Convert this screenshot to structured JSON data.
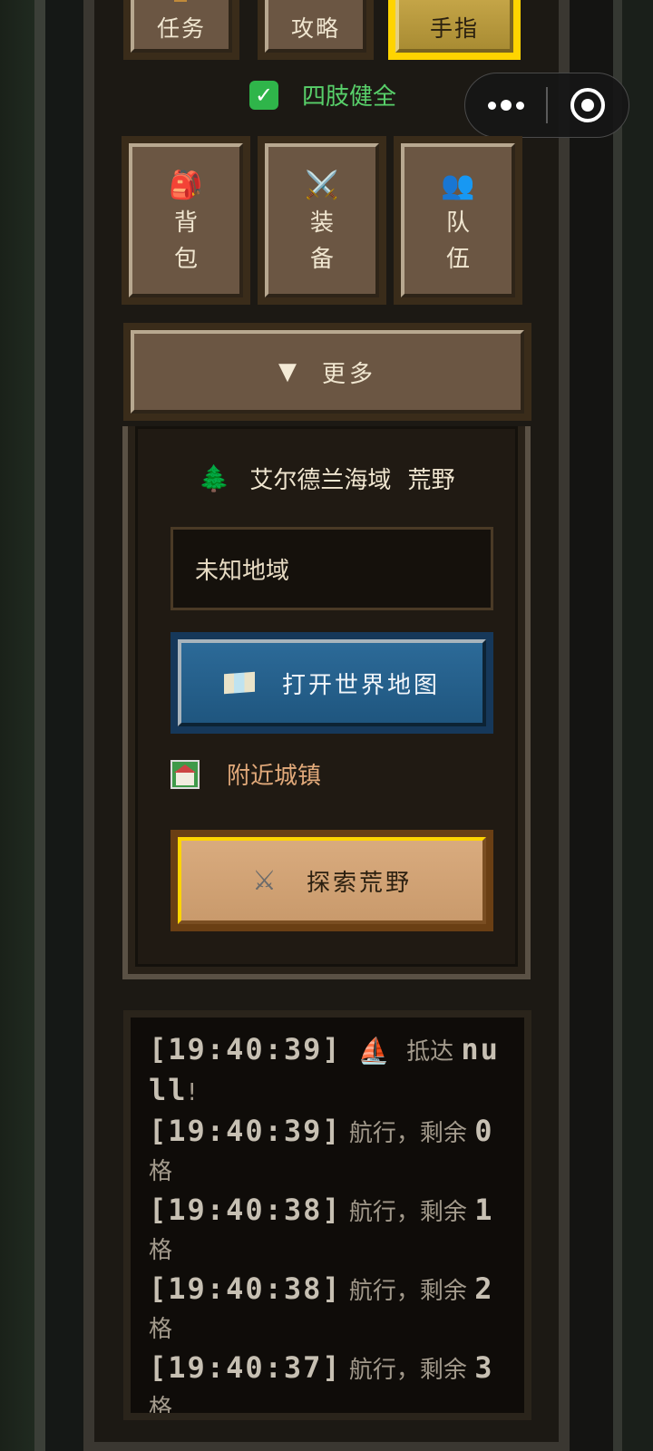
{
  "top_buttons": [
    {
      "label": "任务"
    },
    {
      "label": "攻略"
    },
    {
      "label": "手指",
      "active": true
    }
  ],
  "status": {
    "check_icon": "check-mark-icon",
    "label": "四肢健全",
    "color": "#58d06a"
  },
  "capsule": {
    "more_icon": "more-dots-icon",
    "close_icon": "target-close-icon"
  },
  "actions": [
    {
      "icon": "backpack-icon",
      "glyph": "🎒",
      "label_lines": [
        "背",
        "包"
      ]
    },
    {
      "icon": "crossed-swords-icon",
      "glyph": "⚔️",
      "label_lines": [
        "装",
        "备"
      ]
    },
    {
      "icon": "team-icon",
      "glyph": "👥",
      "label_lines": [
        "队",
        "伍"
      ]
    }
  ],
  "more": {
    "icon": "funnel-icon",
    "label": "更多"
  },
  "location": {
    "icon": "tree-icon",
    "sea": "艾尔德兰海域",
    "terrain": "荒野",
    "region": "未知地域",
    "map_button": "打开世界地图",
    "nearby_towns": "附近城镇",
    "explore_button": "探索荒野"
  },
  "log": [
    {
      "time": "[19:40:39]",
      "icon": "sailboat-icon",
      "glyph": "⛵",
      "prefix": "抵达",
      "value": "null",
      "suffix": "!"
    },
    {
      "time": "[19:40:39]",
      "prefix": "航行，剩余",
      "value": "0",
      "suffix": "格"
    },
    {
      "time": "[19:40:38]",
      "prefix": "航行，剩余",
      "value": "1",
      "suffix": "格"
    },
    {
      "time": "[19:40:38]",
      "prefix": "航行，剩余",
      "value": "2",
      "suffix": "格"
    },
    {
      "time": "[19:40:37]",
      "prefix": "航行，剩余",
      "value": "3",
      "suffix": "格"
    }
  ],
  "colors": {
    "accent_gold": "#ffd400",
    "map_blue": "#2c6a98",
    "panel_brown": "#6b5643",
    "town_text": "#e1a97a"
  }
}
